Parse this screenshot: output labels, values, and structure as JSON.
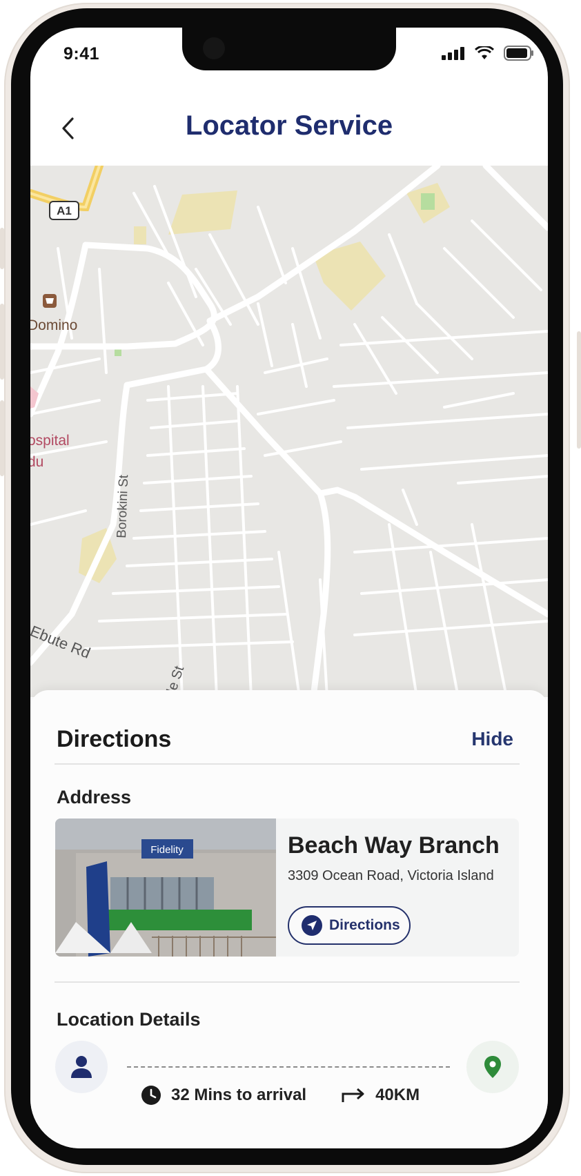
{
  "status_bar": {
    "time": "9:41"
  },
  "header": {
    "title": "Locator Service"
  },
  "map": {
    "labels": {
      "highway": "A1",
      "poi_shop": "Domino",
      "poi_hospital_line1": "ospital",
      "poi_hospital_line2": "du",
      "street1": "Borokini St",
      "street2": "Ebute Rd",
      "street3": "de St"
    },
    "colors": {
      "background": "#e8e7e4",
      "road": "#ffffff",
      "highway": "#f2cf63",
      "park": "#ece3b4"
    }
  },
  "directions": {
    "title": "Directions",
    "hide_label": "Hide",
    "address_label": "Address",
    "branch": {
      "name": "Beach Way Branch",
      "address": "3309 Ocean Road, Victoria Island",
      "button_label": "Directions",
      "photo_sign": "Fidelity"
    },
    "location_details_label": "Location Details",
    "eta": "32 Mins to arrival",
    "distance": "40KM"
  },
  "colors": {
    "primary": "#1f2d6e",
    "pin": "#2e8b3a"
  },
  "icons": [
    "back-chevron-icon",
    "signal-icon",
    "wifi-icon",
    "battery-icon",
    "navigation-arrow-icon",
    "user-icon",
    "location-pin-icon",
    "clock-icon",
    "route-arrow-icon"
  ]
}
